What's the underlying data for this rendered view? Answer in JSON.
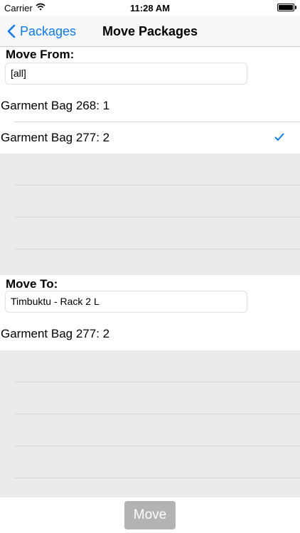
{
  "status_bar": {
    "carrier": "Carrier",
    "time": "11:28 AM"
  },
  "nav": {
    "back_label": "Packages",
    "title": "Move Packages"
  },
  "move_from": {
    "label": "Move From:",
    "field_value": "[all]",
    "items": [
      {
        "label": "Garment Bag 268: 1",
        "checked": false
      },
      {
        "label": "Garment Bag 277: 2",
        "checked": true
      }
    ]
  },
  "move_to": {
    "label": "Move To:",
    "field_value": "Timbuktu - Rack  2 L",
    "items": [
      {
        "label": "Garment Bag 277: 2"
      }
    ]
  },
  "footer": {
    "move_button": "Move"
  },
  "colors": {
    "accent": "#0a7aff",
    "button_disabled": "#b3b3b3",
    "empty_background": "#ebebeb"
  }
}
